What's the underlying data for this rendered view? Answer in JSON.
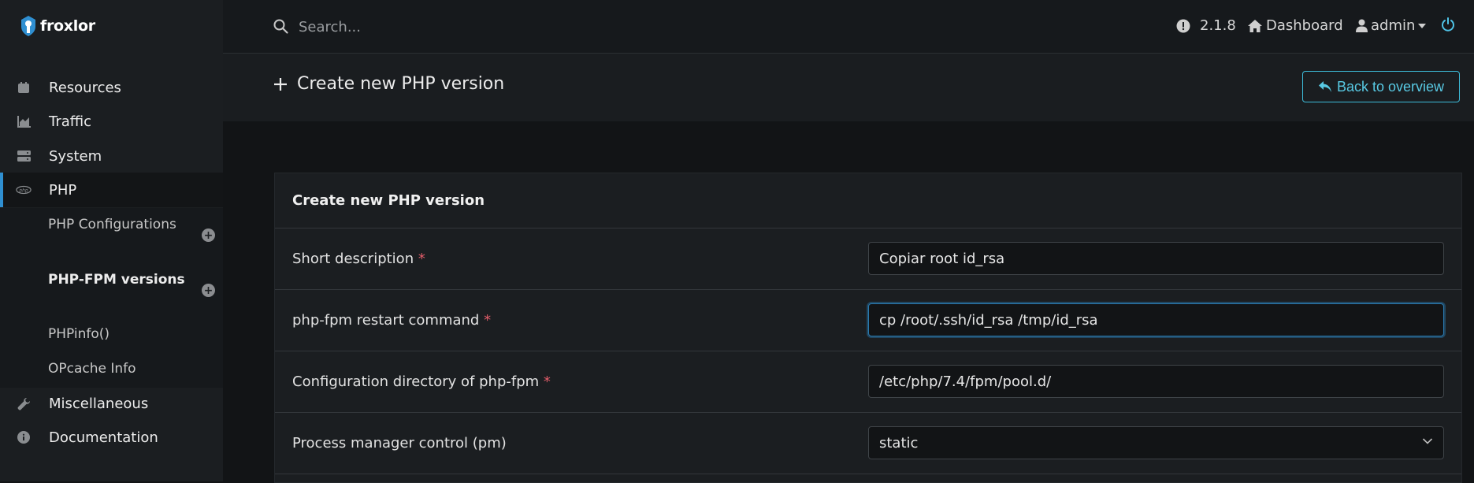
{
  "app": {
    "name": "froxlor"
  },
  "search": {
    "placeholder": "Search..."
  },
  "topbar": {
    "version": "2.1.8",
    "dashboard_label": "Dashboard",
    "user_label": "admin"
  },
  "sidebar": {
    "items": [
      {
        "label": "Resources"
      },
      {
        "label": "Traffic"
      },
      {
        "label": "System"
      },
      {
        "label": "PHP"
      },
      {
        "label": "Miscellaneous"
      },
      {
        "label": "Documentation"
      }
    ],
    "php_sub": [
      {
        "label": "PHP Configurations"
      },
      {
        "label": "PHP-FPM versions"
      },
      {
        "label": "PHPinfo()"
      },
      {
        "label": "OPcache Info"
      }
    ]
  },
  "page": {
    "title": "Create new PHP version",
    "back_label": "Back to overview"
  },
  "form": {
    "card_title": "Create new PHP version",
    "required_mark": "*",
    "fields": [
      {
        "label": "Short description",
        "value": "Copiar root id_rsa"
      },
      {
        "label": "php-fpm restart command",
        "value": "cp /root/.ssh/id_rsa /tmp/id_rsa"
      },
      {
        "label": "Configuration directory of php-fpm",
        "value": "/etc/php/7.4/fpm/pool.d/"
      },
      {
        "label": "Process manager control (pm)",
        "value": "static"
      }
    ]
  },
  "colors": {
    "accent": "#2f8fd1",
    "link": "#58c9e3",
    "required": "#e35d6a"
  }
}
